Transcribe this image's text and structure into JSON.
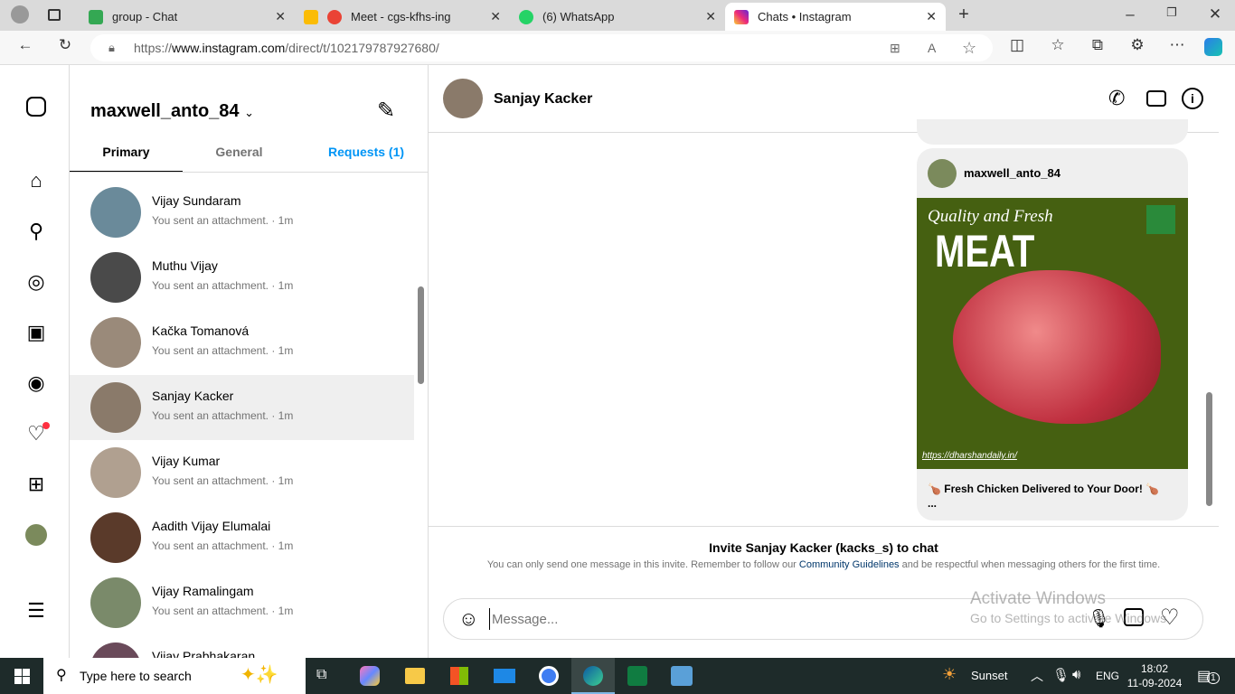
{
  "browser": {
    "tabs": [
      {
        "title": "group - Chat",
        "color": "#34a853"
      },
      {
        "title": "Meet - cgs-kfhs-ing",
        "color": "#ea4335"
      },
      {
        "title": "(6) WhatsApp",
        "color": "#25d366"
      },
      {
        "title": "Chats • Instagram",
        "color": "#d62976",
        "active": true
      }
    ],
    "url_prefix": "https://",
    "url_domain": "www.instagram.com",
    "url_path": "/direct/t/102179787927680/"
  },
  "sidebar": {
    "items": [
      "instagram-logo",
      "home",
      "search",
      "explore",
      "reels",
      "messages",
      "notifications",
      "create",
      "profile",
      "more"
    ],
    "notification_dot_color": "#ff3040"
  },
  "inbox": {
    "username": "maxwell_anto_84",
    "tabs": [
      {
        "label": "Primary"
      },
      {
        "label": "General"
      },
      {
        "label": "Requests (1)"
      }
    ],
    "conversations": [
      {
        "name": "Vijay Sundaram",
        "preview": "You sent an attachment.",
        "time": "1m",
        "color": "#6a8a9a"
      },
      {
        "name": "Muthu Vijay",
        "preview": "You sent an attachment.",
        "time": "1m",
        "color": "#4a4a4a"
      },
      {
        "name": "Kačka Tomanová",
        "preview": "You sent an attachment.",
        "time": "1m",
        "color": "#9a8a7a"
      },
      {
        "name": "Sanjay Kacker",
        "preview": "You sent an attachment.",
        "time": "1m",
        "color": "#8a7a6a",
        "selected": true
      },
      {
        "name": "Vijay Kumar",
        "preview": "You sent an attachment.",
        "time": "1m",
        "color": "#b0a090"
      },
      {
        "name": "Aadith Vijay Elumalai",
        "preview": "You sent an attachment.",
        "time": "1m",
        "color": "#5a3a2a"
      },
      {
        "name": "Vijay Ramalingam",
        "preview": "You sent an attachment.",
        "time": "1m",
        "color": "#7a8a6a"
      },
      {
        "name": "Vijay Prabhakaran",
        "preview": "",
        "time": "",
        "color": "#6a4a5a"
      }
    ]
  },
  "chat": {
    "contact": "Sanjay Kacker",
    "post": {
      "author": "maxwell_anto_84",
      "headline": "Quality and Fresh",
      "big": "MEAT",
      "link": "https://dharshandaily.in/",
      "caption": "🍗 Fresh Chicken Delivered to Your Door! 🍗",
      "more": "...",
      "bg": "#456011"
    },
    "invite_title": "Invite Sanjay Kacker (kacks_s) to chat",
    "invite_text_1": "You can only send one message in this invite. Remember to follow our ",
    "invite_link": "Community Guidelines",
    "invite_text_2": " and be respectful when messaging others for the first time.",
    "placeholder": "Message...",
    "watermark_1": "Activate Windows",
    "watermark_2": "Go to Settings to activate Windows."
  },
  "taskbar": {
    "search_placeholder": "Type here to search",
    "weather": "Sunset",
    "lang": "ENG",
    "time": "18:02",
    "date": "11-09-2024",
    "notifications": "1"
  }
}
